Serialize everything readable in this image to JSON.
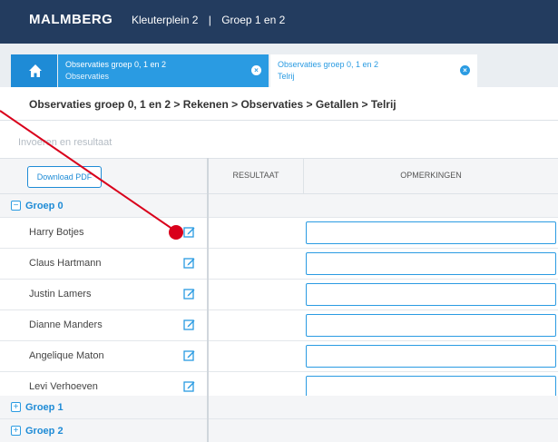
{
  "header": {
    "logo": "MALMBERG",
    "school": "Kleuterplein 2",
    "separator": "|",
    "group": "Groep 1 en 2"
  },
  "tabs": [
    {
      "title": "Observaties groep 0, 1 en 2",
      "subtitle": "Observaties",
      "active": false
    },
    {
      "title": "Observaties groep 0, 1 en 2",
      "subtitle": "Telrij",
      "active": true
    }
  ],
  "breadcrumb": "Observaties groep 0, 1 en 2 > Rekenen > Observaties > Getallen > Telrij",
  "section_title": "Invoeren en resultaat",
  "table": {
    "download_label": "Download PDF",
    "columns": [
      "RESULTAAT",
      "OPMERKINGEN"
    ],
    "groups": [
      {
        "label": "Groep 0",
        "toggle": "−",
        "expanded": true,
        "students": [
          "Harry Botjes",
          "Claus Hartmann",
          "Justin Lamers",
          "Dianne Manders",
          "Angelique Maton",
          "Levi Verhoeven"
        ]
      },
      {
        "label": "Groep 1",
        "toggle": "+",
        "expanded": false,
        "students": []
      },
      {
        "label": "Groep 2",
        "toggle": "+",
        "expanded": false,
        "students": []
      }
    ]
  },
  "icons": {
    "home": "home-icon",
    "close": "close-icon",
    "edit": "edit-icon"
  },
  "colors": {
    "topbar": "#233c5f",
    "accent": "#1e8bd6",
    "annotation": "#d9001b"
  }
}
